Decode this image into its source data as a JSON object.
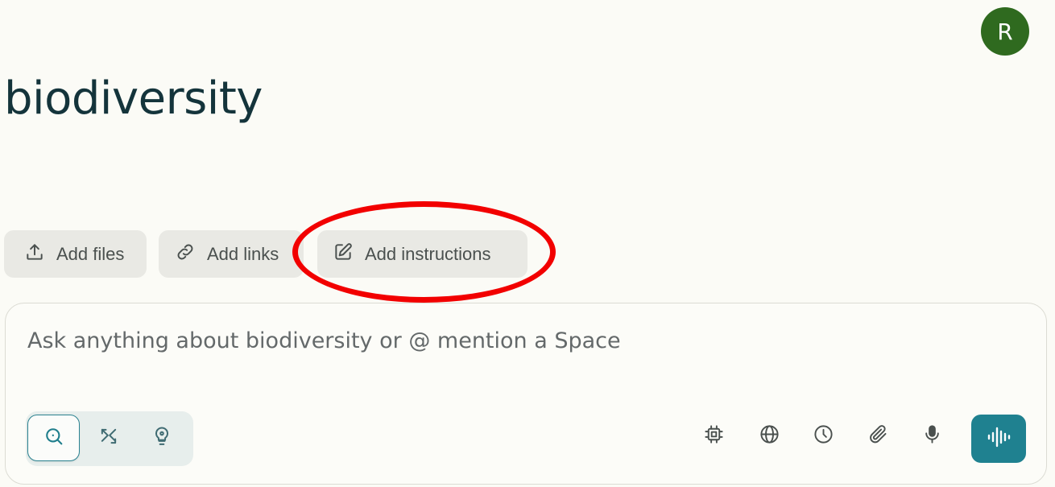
{
  "user": {
    "avatar_initial": "R",
    "avatar_color": "#2f6a1f"
  },
  "space": {
    "title": "biodiversity"
  },
  "actions": {
    "add_files": {
      "label": "Add files",
      "icon": "upload-icon"
    },
    "add_links": {
      "label": "Add links",
      "icon": "link-icon"
    },
    "add_instructions": {
      "label": "Add instructions",
      "icon": "edit-icon",
      "highlighted": true,
      "highlight_color": "#f20000"
    }
  },
  "composer": {
    "placeholder": "Ask anything about biodiversity or @ mention a Space",
    "value": "",
    "modes": [
      {
        "name": "search",
        "icon": "search-icon",
        "selected": true
      },
      {
        "name": "research",
        "icon": "research-icon",
        "selected": false
      },
      {
        "name": "labs",
        "icon": "lightbulb-icon",
        "selected": false
      }
    ],
    "tools": [
      {
        "name": "model",
        "icon": "cpu-chip-icon"
      },
      {
        "name": "sources",
        "icon": "globe-icon"
      },
      {
        "name": "history",
        "icon": "clock-icon"
      },
      {
        "name": "attach",
        "icon": "paperclip-icon"
      },
      {
        "name": "dictate",
        "icon": "microphone-icon"
      }
    ],
    "voice_button": {
      "icon": "waveform-icon",
      "color": "#1f8190"
    }
  },
  "colors": {
    "background": "#fbfbf6",
    "accent": "#1f8190",
    "chip_bg": "#e9e9e4"
  }
}
